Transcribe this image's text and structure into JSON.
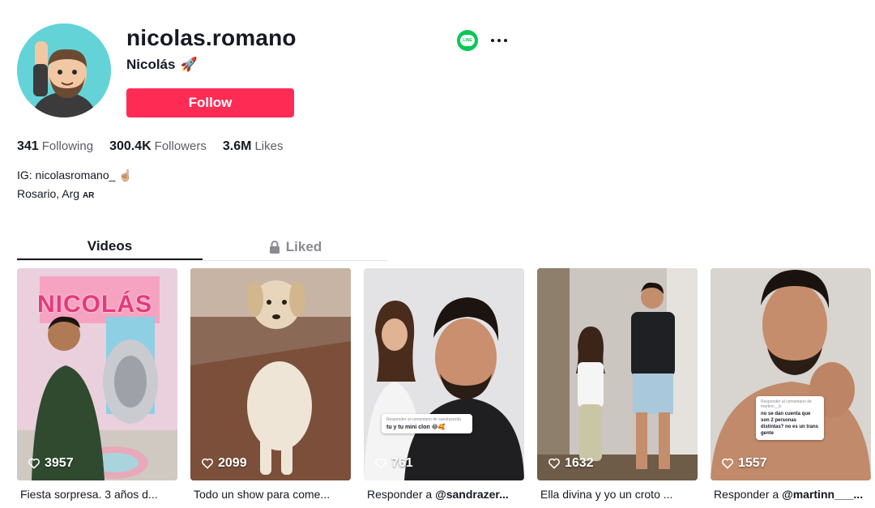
{
  "profile": {
    "username": "nicolas.romano",
    "nickname": "Nicolás",
    "nickname_emoji": "🚀",
    "follow_label": "Follow",
    "line_icon": "LINE"
  },
  "stats": {
    "following_count": "341",
    "following_label": "Following",
    "followers_count": "300.4K",
    "followers_label": "Followers",
    "likes_count": "3.6M",
    "likes_label": "Likes"
  },
  "bio": {
    "line1": "IG: nicolasromano_",
    "line1_emoji": "☝🏼",
    "line2": "Rosario, Arg",
    "line2_flag": "AR"
  },
  "tabs": {
    "videos": "Videos",
    "liked": "Liked"
  },
  "videos": [
    {
      "views": "3957",
      "caption": "Fiesta sorpresa. 3 años d...",
      "caption_prefix": "",
      "caption_mention": ""
    },
    {
      "views": "2099",
      "caption": "Todo un show para come...",
      "caption_prefix": "",
      "caption_mention": ""
    },
    {
      "views": "761",
      "caption": "",
      "caption_prefix": "Responder a ",
      "caption_mention": "@sandrazer..."
    },
    {
      "views": "1632",
      "caption": "Ella divina y yo un croto ...",
      "caption_prefix": "",
      "caption_mention": ""
    },
    {
      "views": "1557",
      "caption": "",
      "caption_prefix": "Responder a ",
      "caption_mention": "@martinn___..."
    }
  ],
  "overlays": {
    "v3_reply_header": "Responder al comentario de sandrazerda",
    "v3_reply_text": "tu y tu mini clon 😂🥰",
    "v5_reply_header": "Responder al comentario de martinn__b",
    "v5_reply_text": "no se dan cuenta que son 2 personas distintas? no es un trans gente",
    "v1_banner": "NICOLÁS"
  },
  "colors": {
    "accent": "#fe2c55",
    "line_green": "#06c755",
    "avatar_bg": "#63d3d8"
  }
}
